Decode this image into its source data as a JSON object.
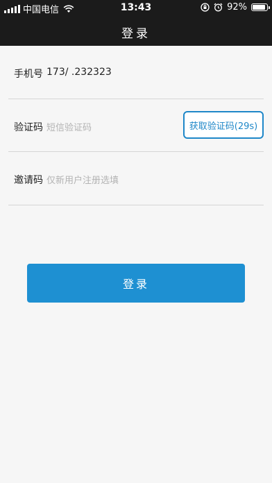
{
  "status_bar": {
    "carrier": "中国电信",
    "time": "13:43",
    "battery": "92%",
    "battery_level": 0.92
  },
  "header": {
    "title": "登录"
  },
  "form": {
    "phone": {
      "label": "手机号",
      "value": "173/ .232323"
    },
    "code": {
      "label": "验证码",
      "placeholder": "短信验证码",
      "button": "获取验证码(29s)"
    },
    "invite": {
      "label": "邀请码",
      "placeholder": "仅新用户注册选填"
    }
  },
  "login_button": "登录",
  "colors": {
    "accent": "#1e90d2",
    "topbar": "#1b1b1b"
  }
}
